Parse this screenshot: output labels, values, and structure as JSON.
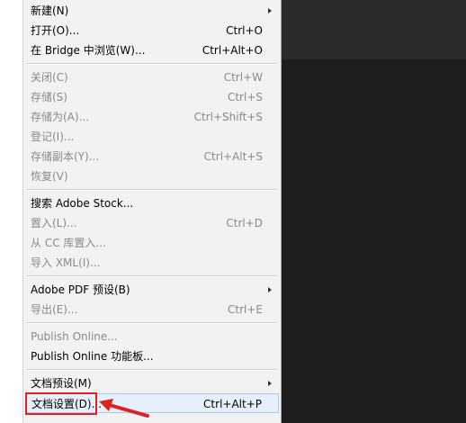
{
  "menu": {
    "items": [
      {
        "label": "新建(N)",
        "shortcut": "",
        "disabled": false,
        "submenu": true
      },
      {
        "label": "打开(O)...",
        "shortcut": "Ctrl+O",
        "disabled": false,
        "submenu": false
      },
      {
        "label": "在 Bridge 中浏览(W)...",
        "shortcut": "Ctrl+Alt+O",
        "disabled": false,
        "submenu": false
      },
      {
        "label": "关闭(C)",
        "shortcut": "Ctrl+W",
        "disabled": true,
        "submenu": false
      },
      {
        "label": "存储(S)",
        "shortcut": "Ctrl+S",
        "disabled": true,
        "submenu": false
      },
      {
        "label": "存储为(A)...",
        "shortcut": "Ctrl+Shift+S",
        "disabled": true,
        "submenu": false
      },
      {
        "label": "登记(I)...",
        "shortcut": "",
        "disabled": true,
        "submenu": false
      },
      {
        "label": "存储副本(Y)...",
        "shortcut": "Ctrl+Alt+S",
        "disabled": true,
        "submenu": false
      },
      {
        "label": "恢复(V)",
        "shortcut": "",
        "disabled": true,
        "submenu": false
      },
      {
        "label": "搜索 Adobe Stock...",
        "shortcut": "",
        "disabled": false,
        "submenu": false
      },
      {
        "label": "置入(L)...",
        "shortcut": "Ctrl+D",
        "disabled": true,
        "submenu": false
      },
      {
        "label": "从 CC 库置入...",
        "shortcut": "",
        "disabled": true,
        "submenu": false
      },
      {
        "label": "导入 XML(I)...",
        "shortcut": "",
        "disabled": true,
        "submenu": false
      },
      {
        "label": "Adobe PDF 预设(B)",
        "shortcut": "",
        "disabled": false,
        "submenu": true
      },
      {
        "label": "导出(E)...",
        "shortcut": "Ctrl+E",
        "disabled": true,
        "submenu": false
      },
      {
        "label": "Publish Online...",
        "shortcut": "",
        "disabled": true,
        "submenu": false
      },
      {
        "label": "Publish Online 功能板...",
        "shortcut": "",
        "disabled": false,
        "submenu": false
      },
      {
        "label": "文档预设(M)",
        "shortcut": "",
        "disabled": false,
        "submenu": true
      },
      {
        "label": "文档设置(D)...",
        "shortcut": "Ctrl+Alt+P",
        "disabled": false,
        "submenu": false,
        "highlighted": true
      }
    ]
  },
  "colors": {
    "menu_bg": "#f2f2f2",
    "disabled_text": "#8a8a8a",
    "highlight_bg": "#e6f0fb",
    "annotation_red": "#e02020",
    "app_background": "#1e1e1e"
  }
}
